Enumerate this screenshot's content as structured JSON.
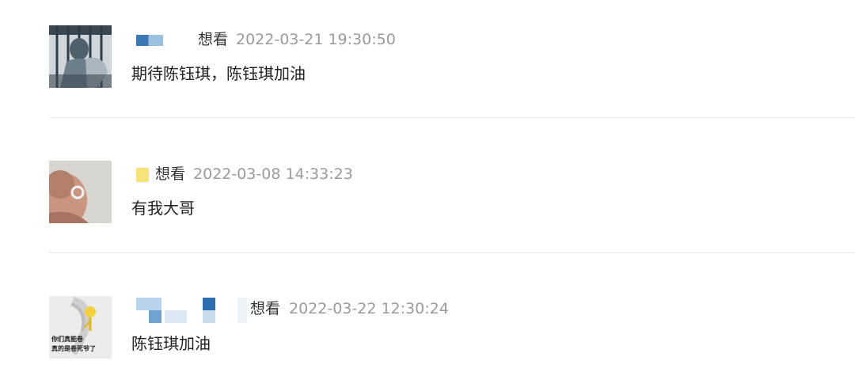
{
  "comments": [
    {
      "status": "想看",
      "time": "2022-03-21 19:30:50",
      "text": "期待陈钰琪，陈钰琪加油"
    },
    {
      "status": "想看",
      "time": "2022-03-08 14:33:23",
      "text": "有我大哥"
    },
    {
      "status": "想看",
      "time": "2022-03-22 12:30:24",
      "text": "陈钰琪加油",
      "avatar_caption_line1": "你们真能卷",
      "avatar_caption_line2": "真的是卷死爷了"
    }
  ]
}
